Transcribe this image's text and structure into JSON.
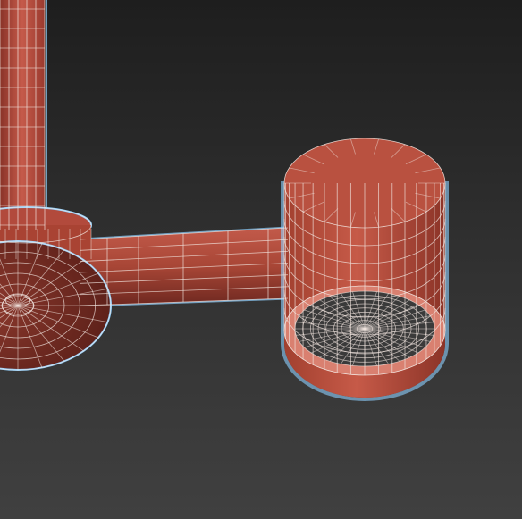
{
  "viewport": {
    "colors": {
      "background_top": "#1e1e1e",
      "background_bottom": "#404040",
      "mesh_fill": "#b24a3c",
      "mesh_fill_dark": "#7a2a22",
      "mesh_fill_light": "#c95e4e",
      "wire": "#f2e6e0",
      "selection_outline": "#8fd0ff"
    },
    "objects": [
      "vertical-rod",
      "ceiling-base-disc",
      "horizontal-arm",
      "spot-cylinder"
    ]
  }
}
